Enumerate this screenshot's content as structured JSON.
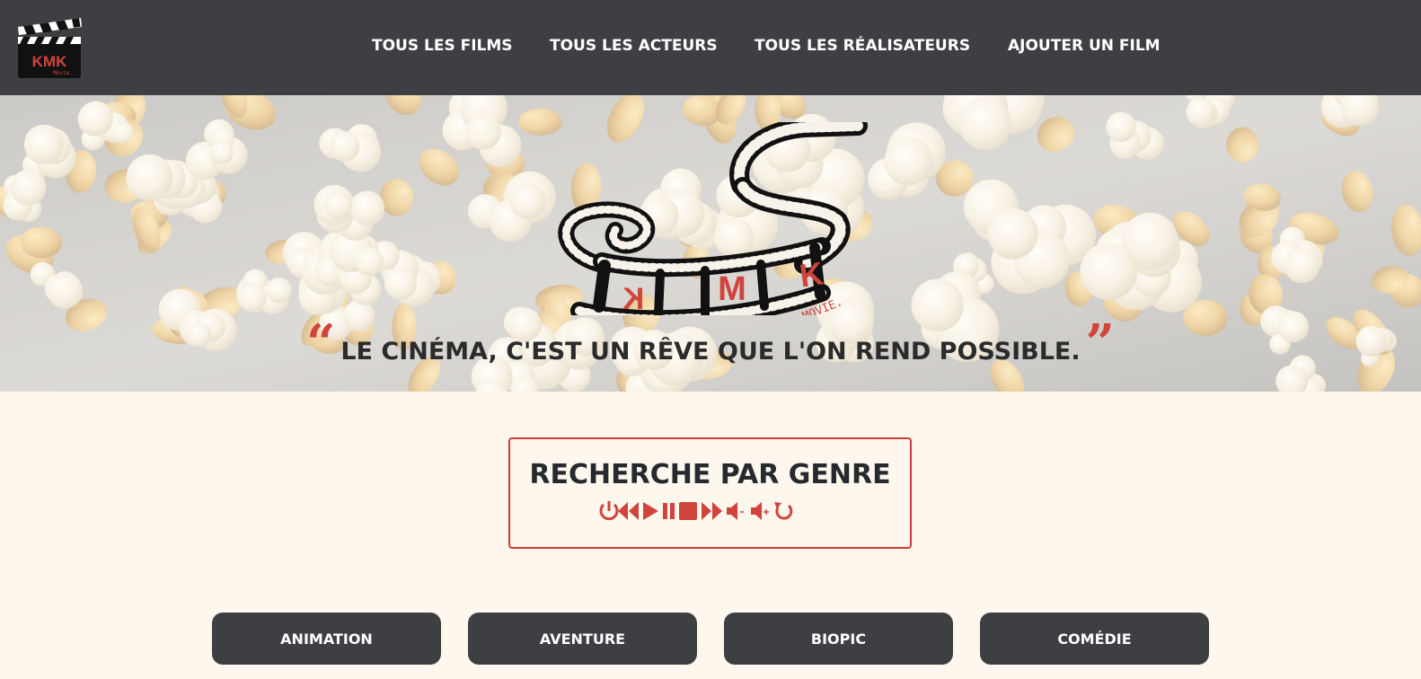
{
  "nav": {
    "logo": {
      "brand_letters": "KMK",
      "brand_sub": "Movie.",
      "icon": "clapperboard-icon"
    },
    "links": [
      {
        "label": "TOUS LES FILMS"
      },
      {
        "label": "TOUS LES ACTEURS"
      },
      {
        "label": "TOUS LES RÉALISATEURS"
      },
      {
        "label": "AJOUTER UN FILM"
      }
    ]
  },
  "hero": {
    "background": "popcorn-photo",
    "logo": {
      "letters": [
        "K",
        "M",
        "K"
      ],
      "sub": "MOVIE.",
      "icon": "film-strip-icon"
    },
    "quote_open": "“",
    "quote_close": "”",
    "quote": "LE CINÉMA, C'EST UN RÊVE QUE L'ON REND POSSIBLE."
  },
  "genre_search": {
    "title": "RECHERCHE PAR GENRE",
    "controls": [
      "power-icon",
      "rewind-icon",
      "play-icon",
      "pause-icon",
      "stop-icon",
      "fast-forward-icon",
      "volume-down-icon",
      "volume-up-icon",
      "replay-icon"
    ]
  },
  "genres": [
    {
      "label": "ANIMATION"
    },
    {
      "label": "AVENTURE"
    },
    {
      "label": "BIOPIC"
    },
    {
      "label": "COMÉDIE"
    }
  ],
  "colors": {
    "nav_bg": "#3e3f42",
    "accent_red": "#cf3b37",
    "page_bg": "#fef7ee",
    "button_bg": "#3e3f42"
  }
}
